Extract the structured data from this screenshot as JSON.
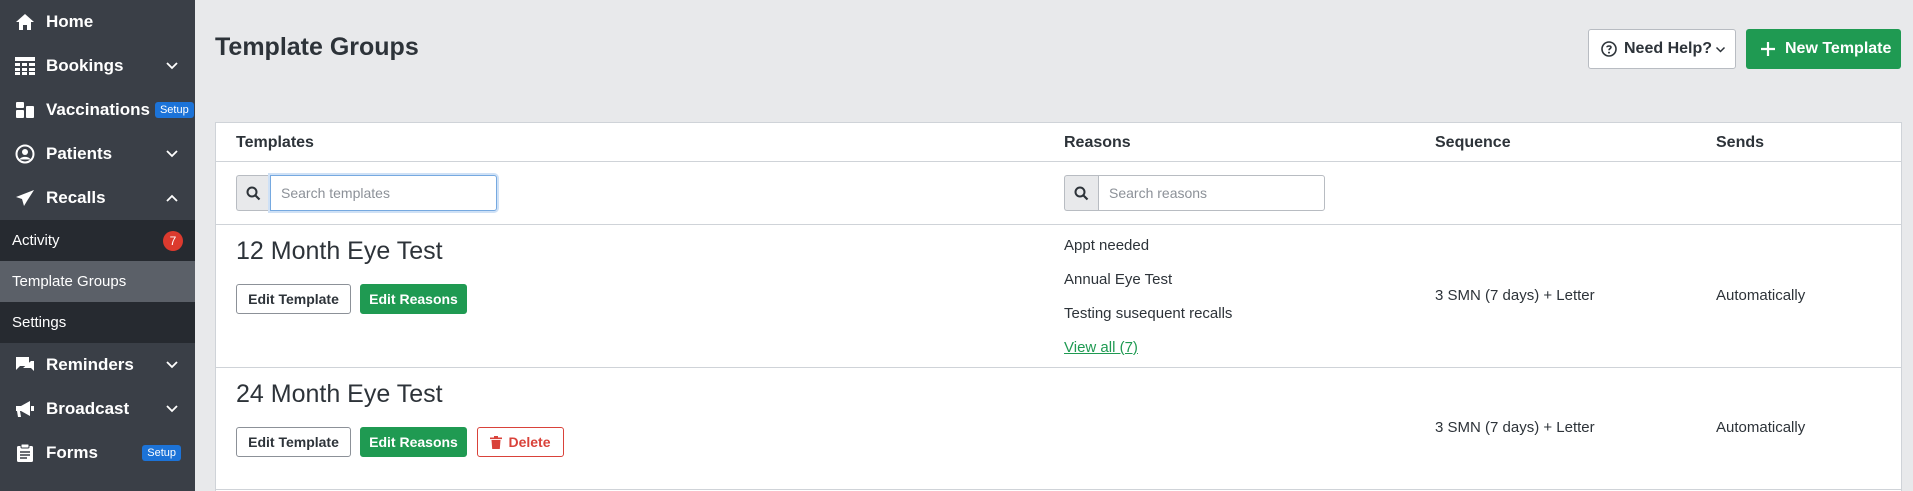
{
  "sidebar": {
    "items": [
      {
        "label": "Home",
        "icon": "home-icon"
      },
      {
        "label": "Bookings",
        "icon": "grid-icon"
      },
      {
        "label": "Vaccinations",
        "icon": "vial-icon",
        "badge": "Setup"
      },
      {
        "label": "Patients",
        "icon": "user-circle-icon"
      },
      {
        "label": "Recalls",
        "icon": "paper-plane-icon"
      },
      {
        "label": "Reminders",
        "icon": "chat-icon"
      },
      {
        "label": "Broadcast",
        "icon": "megaphone-icon"
      },
      {
        "label": "Forms",
        "icon": "clipboard-icon",
        "badge": "Setup"
      }
    ],
    "recalls_sub": [
      {
        "label": "Activity",
        "count": "7"
      },
      {
        "label": "Template Groups"
      },
      {
        "label": "Settings"
      }
    ]
  },
  "header": {
    "title": "Template Groups",
    "help_label": "Need Help?",
    "new_label": "New Template"
  },
  "table": {
    "columns": [
      "Templates",
      "Reasons",
      "Sequence",
      "Sends"
    ],
    "search_templates_placeholder": "Search templates",
    "search_reasons_placeholder": "Search reasons",
    "rows": [
      {
        "name": "12 Month Eye Test",
        "edit_template": "Edit Template",
        "edit_reasons": "Edit Reasons",
        "reasons": [
          "Appt needed",
          "Annual Eye Test",
          "Testing susequent recalls"
        ],
        "view_all": "View all (7)",
        "sequence": "3 SMN (7 days) + Letter",
        "sends": "Automatically"
      },
      {
        "name": "24 Month Eye Test",
        "edit_template": "Edit Template",
        "edit_reasons": "Edit Reasons",
        "delete": "Delete",
        "sequence": "3 SMN (7 days) + Letter",
        "sends": "Automatically"
      }
    ]
  },
  "colors": {
    "sidebar_bg": "#3a3f47",
    "sub_bg": "#262a30",
    "active_bg": "#5b6068",
    "accent_green": "#1f9a52",
    "setup_badge": "#1c73d8",
    "count_badge": "#dc3a2e",
    "danger": "#d9423a"
  }
}
